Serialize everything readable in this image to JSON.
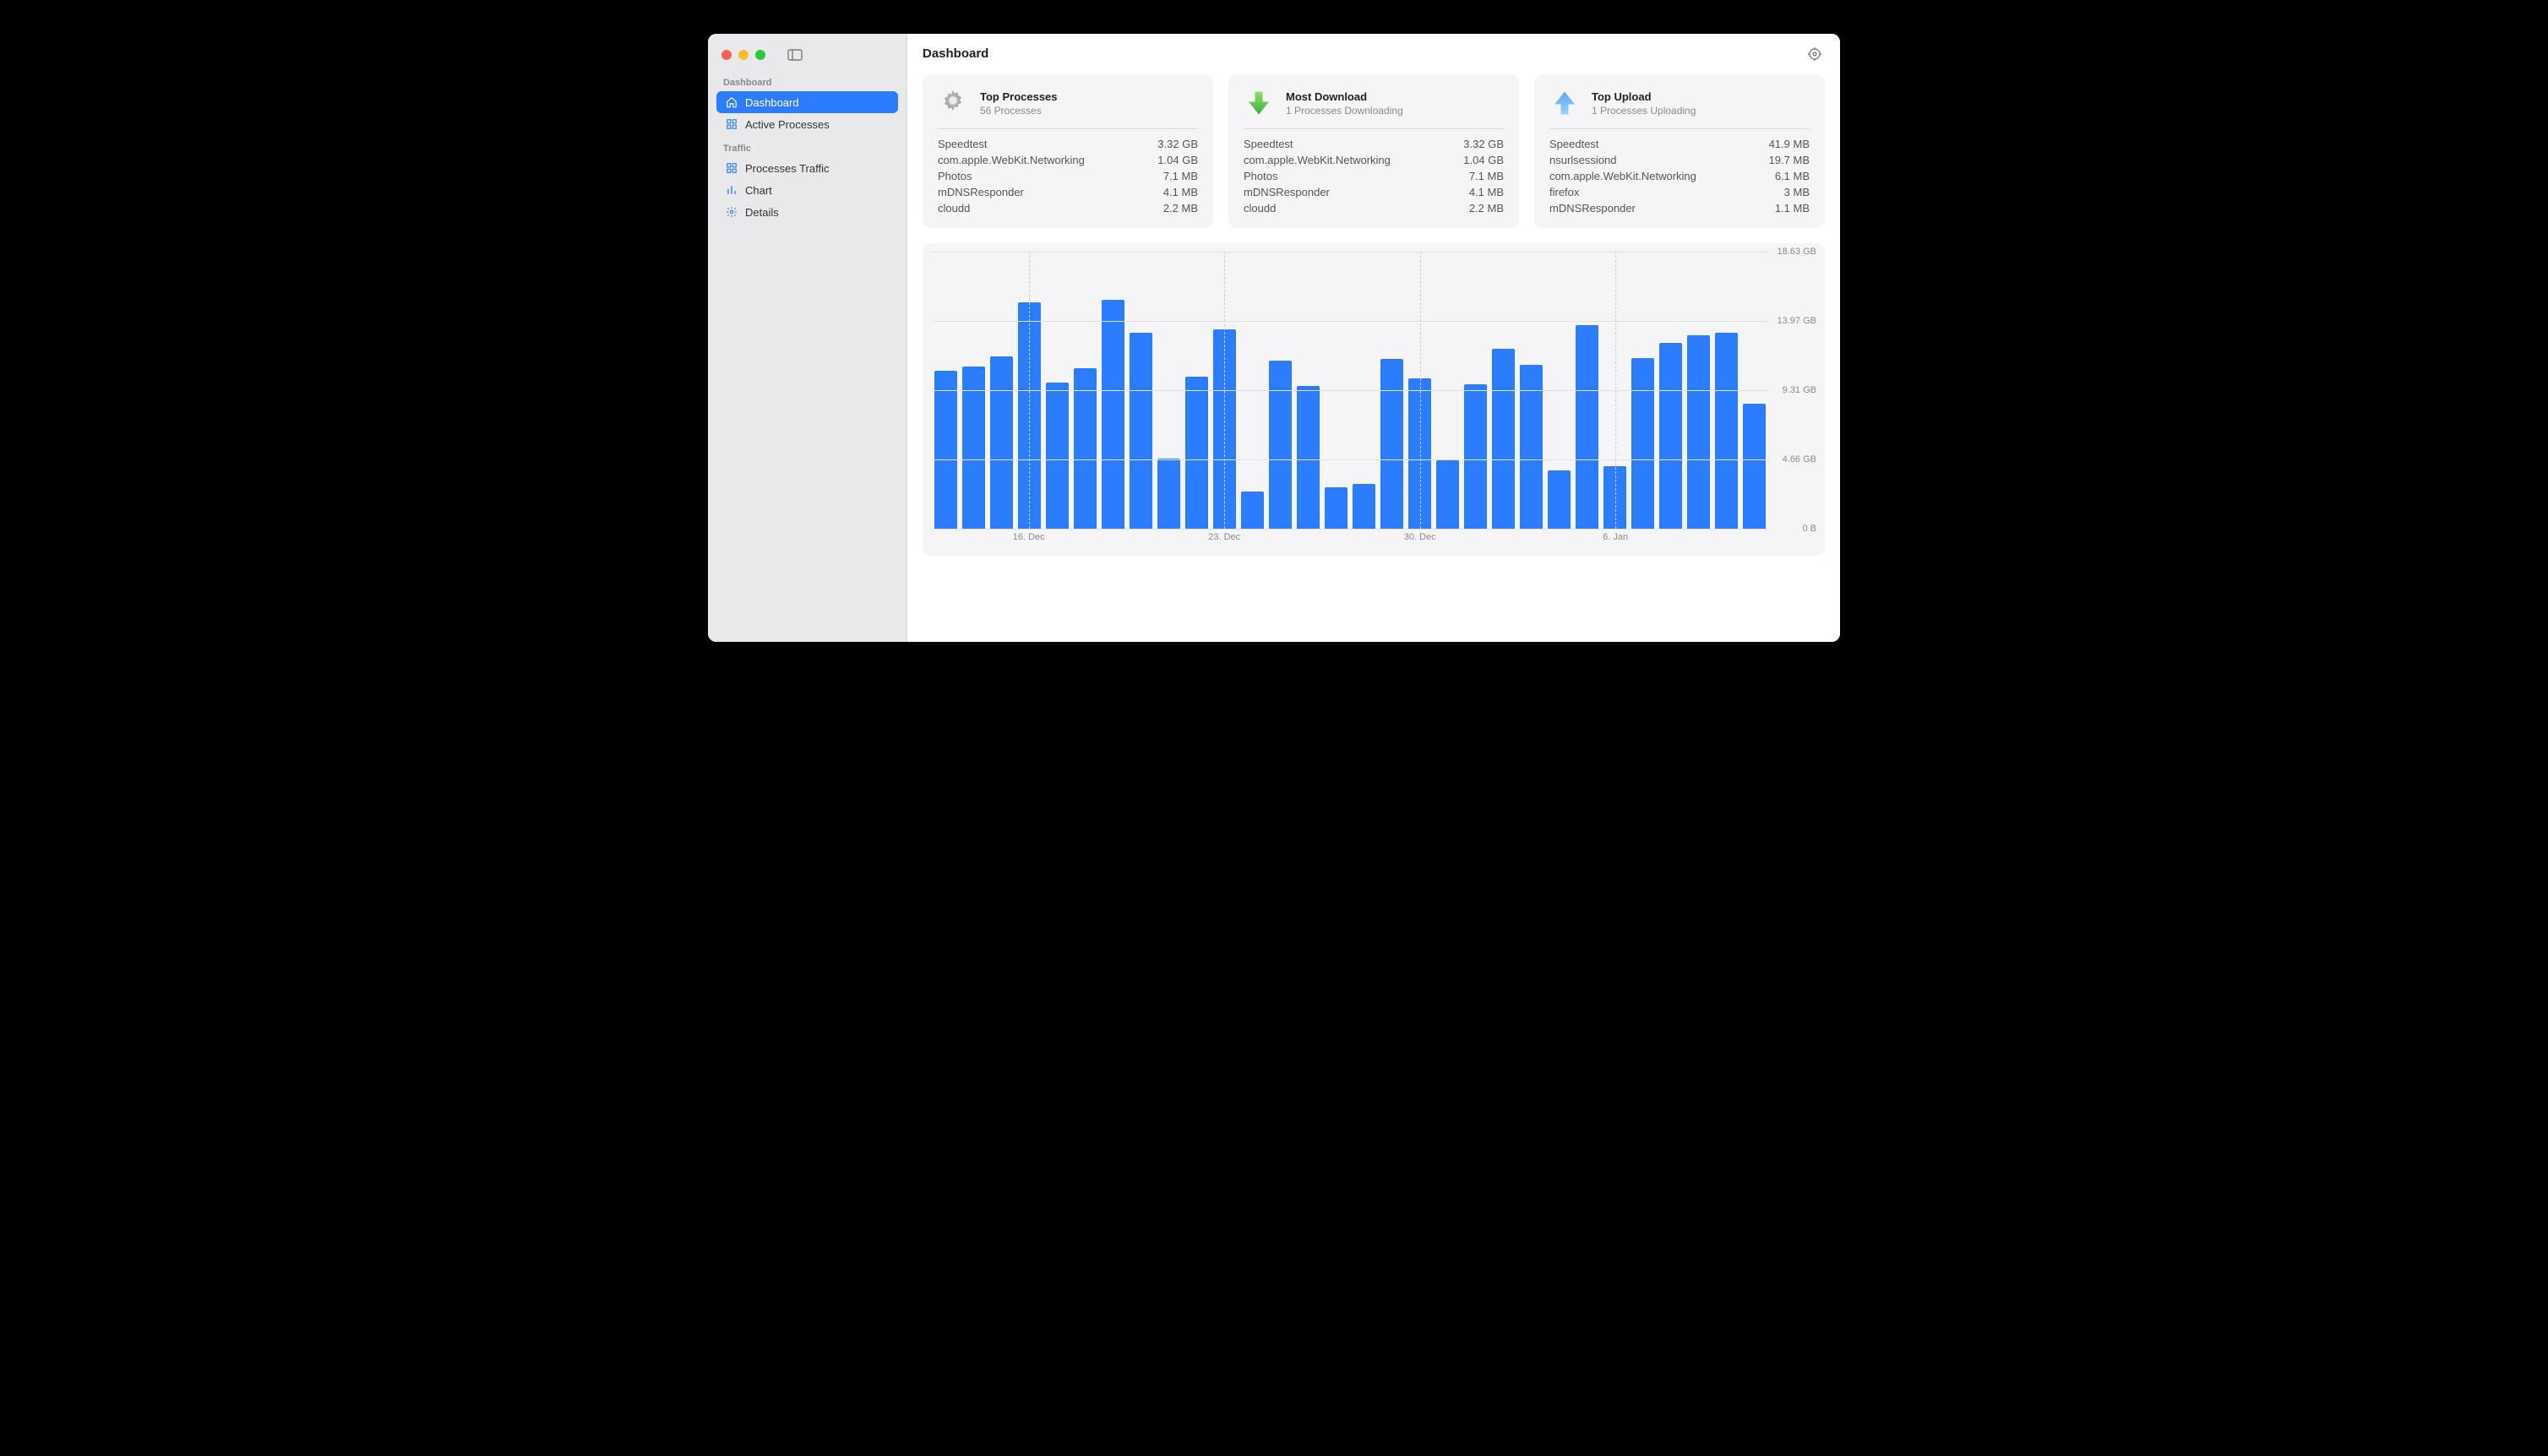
{
  "header": {
    "title": "Dashboard"
  },
  "sidebar": {
    "sections": [
      {
        "label": "Dashboard",
        "items": [
          {
            "label": "Dashboard",
            "icon": "home-icon",
            "active": true
          },
          {
            "label": "Active Processes",
            "icon": "grid-icon",
            "active": false
          }
        ]
      },
      {
        "label": "Traffic",
        "items": [
          {
            "label": "Processes Traffic",
            "icon": "grid-icon",
            "active": false
          },
          {
            "label": "Chart",
            "icon": "bars-icon",
            "active": false
          },
          {
            "label": "Details",
            "icon": "gear-small-icon",
            "active": false
          }
        ]
      }
    ]
  },
  "cards": [
    {
      "id": "top-processes",
      "title": "Top Processes",
      "subtitle": "56 Processes",
      "icon": "gear-icon",
      "rows": [
        {
          "name": "Speedtest",
          "value": "3.32 GB"
        },
        {
          "name": "com.apple.WebKit.Networking",
          "value": "1.04 GB"
        },
        {
          "name": "Photos",
          "value": "7.1 MB"
        },
        {
          "name": "mDNSResponder",
          "value": "4.1 MB"
        },
        {
          "name": "cloudd",
          "value": "2.2 MB"
        }
      ]
    },
    {
      "id": "most-download",
      "title": "Most Download",
      "subtitle": "1 Processes Downloading",
      "icon": "arrow-down-icon",
      "rows": [
        {
          "name": "Speedtest",
          "value": "3.32 GB"
        },
        {
          "name": "com.apple.WebKit.Networking",
          "value": "1.04 GB"
        },
        {
          "name": "Photos",
          "value": "7.1 MB"
        },
        {
          "name": "mDNSResponder",
          "value": "4.1 MB"
        },
        {
          "name": "cloudd",
          "value": "2.2 MB"
        }
      ]
    },
    {
      "id": "top-upload",
      "title": "Top Upload",
      "subtitle": "1 Processes Uploading",
      "icon": "arrow-up-icon",
      "rows": [
        {
          "name": "Speedtest",
          "value": "41.9 MB"
        },
        {
          "name": "nsurlsessiond",
          "value": "19.7 MB"
        },
        {
          "name": "com.apple.WebKit.Networking",
          "value": "6.1 MB"
        },
        {
          "name": "firefox",
          "value": "3 MB"
        },
        {
          "name": "mDNSResponder",
          "value": "1.1 MB"
        }
      ]
    }
  ],
  "chart_data": {
    "type": "bar",
    "title": "",
    "xlabel": "",
    "ylabel": "",
    "ylim": [
      0,
      18.63
    ],
    "yticks": [
      {
        "value": 0,
        "label": "0 B"
      },
      {
        "value": 4.66,
        "label": "4.66 GB"
      },
      {
        "value": 9.31,
        "label": "9.31 GB"
      },
      {
        "value": 13.97,
        "label": "13.97 GB"
      },
      {
        "value": 18.63,
        "label": "18.63 GB"
      }
    ],
    "xticks": [
      {
        "index": 3,
        "label": "16. Dec"
      },
      {
        "index": 10,
        "label": "23. Dec"
      },
      {
        "index": 17,
        "label": "30. Dec"
      },
      {
        "index": 24,
        "label": "6. Jan"
      }
    ],
    "values": [
      10.6,
      10.9,
      11.6,
      15.2,
      9.8,
      10.8,
      15.4,
      13.2,
      4.7,
      10.2,
      13.4,
      2.5,
      11.3,
      9.6,
      2.8,
      3.0,
      11.4,
      10.1,
      4.6,
      9.7,
      12.1,
      11.0,
      3.9,
      13.7,
      4.2,
      11.5,
      12.5,
      13.0,
      13.2,
      8.4
    ]
  }
}
